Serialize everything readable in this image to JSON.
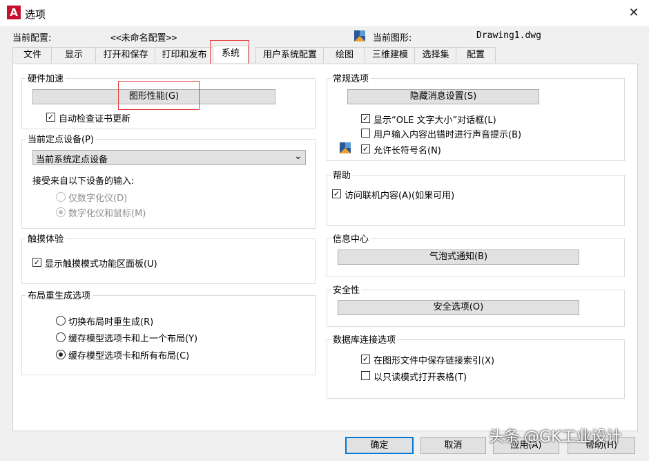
{
  "window": {
    "title": "选项",
    "app_icon_letter": "A",
    "close_glyph": "✕"
  },
  "header": {
    "profile_label": "当前配置:",
    "profile_value": "<<未命名配置>>",
    "drawing_label": "当前图形:",
    "drawing_value": "Drawing1.dwg"
  },
  "tabs": [
    "文件",
    "显示",
    "打开和保存",
    "打印和发布",
    "系统",
    "用户系统配置",
    "绘图",
    "三维建模",
    "选择集",
    "配置"
  ],
  "active_tab": "系统",
  "hardware": {
    "title": "硬件加速",
    "graphics_button": "图形性能(G)",
    "auto_check_label": "自动检查证书更新",
    "auto_check": true
  },
  "pointing": {
    "title": "当前定点设备(P)",
    "selected": "当前系统定点设备",
    "accept_label": "接受来自以下设备的输入:",
    "opt_digitizer": "仅数字化仪(D)",
    "opt_digitizer_mouse": "数字化仪和鼠标(M)"
  },
  "touch": {
    "title": "触摸体验",
    "show_panel_label": "显示触摸模式功能区面板(U)",
    "show_panel": true
  },
  "layout_regen": {
    "title": "布局重生成选项",
    "opt1": "切换布局时重生成(R)",
    "opt2": "缓存模型选项卡和上一个布局(Y)",
    "opt3": "缓存模型选项卡和所有布局(C)",
    "selected": 3
  },
  "general": {
    "title": "常规选项",
    "hidden_msg_button": "隐藏消息设置(S)",
    "ole_label": "显示“OLE 文字大小”对话框(L)",
    "ole": true,
    "beep_label": "用户输入内容出错时进行声音提示(B)",
    "beep": false,
    "long_names_label": "允许长符号名(N)",
    "long_names": true
  },
  "help": {
    "title": "帮助",
    "online_label": "访问联机内容(A)(如果可用)",
    "online": true
  },
  "info_center": {
    "title": "信息中心",
    "balloon_button": "气泡式通知(B)"
  },
  "security": {
    "title": "安全性",
    "security_button": "安全选项(O)"
  },
  "database": {
    "title": "数据库连接选项",
    "save_index_label": "在图形文件中保存链接索引(X)",
    "save_index": true,
    "readonly_label": "以只读模式打开表格(T)",
    "readonly": false
  },
  "footer": {
    "ok": "确定",
    "cancel": "取消",
    "apply": "应用(A)",
    "help": "帮助(H)"
  },
  "watermark": "头条 @GK工业设计",
  "check_glyph": "✓",
  "dropdown_glyph": "⌄",
  "colors": {
    "accent_red": "#c8102e",
    "highlight_box": "#e63b3b"
  }
}
